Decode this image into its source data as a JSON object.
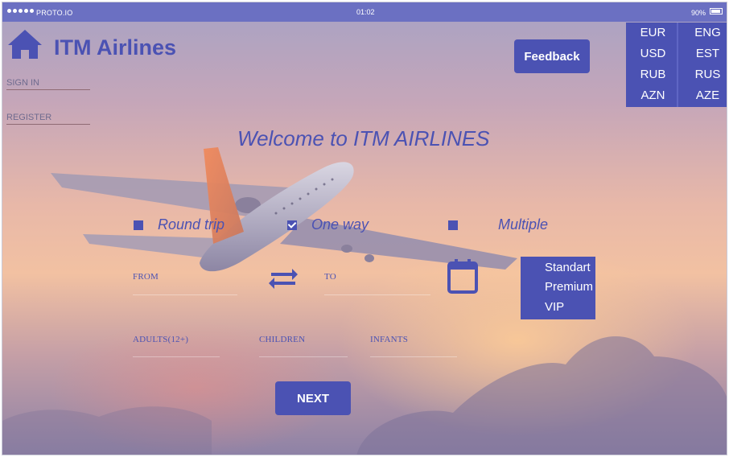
{
  "status_bar": {
    "carrier": "PROTO.IO",
    "time": "01:02",
    "battery": "90%"
  },
  "header": {
    "brand": "ITM Airlines",
    "sign_in": "SIGN IN",
    "register": "REGISTER",
    "feedback": "Feedback"
  },
  "picker": {
    "currencies": [
      "EUR",
      "USD",
      "RUB",
      "AZN"
    ],
    "languages": [
      "ENG",
      "EST",
      "RUS",
      "AZE"
    ]
  },
  "welcome": "Welcome to ITM AIRLINES",
  "trip_types": [
    {
      "label": "Round trip",
      "checked": false
    },
    {
      "label": "One way",
      "checked": true
    },
    {
      "label": "Multiple",
      "checked": false
    }
  ],
  "fields": {
    "from": "FROM",
    "to": "TO",
    "adults": "ADULTS(12+)",
    "children": "CHILDREN",
    "infants": "INFANTS"
  },
  "travel_classes": [
    "Standart",
    "Premium",
    "VIP"
  ],
  "next": "NEXT",
  "colors": {
    "accent": "#4b52b3",
    "status_bar": "#6b70c2"
  }
}
